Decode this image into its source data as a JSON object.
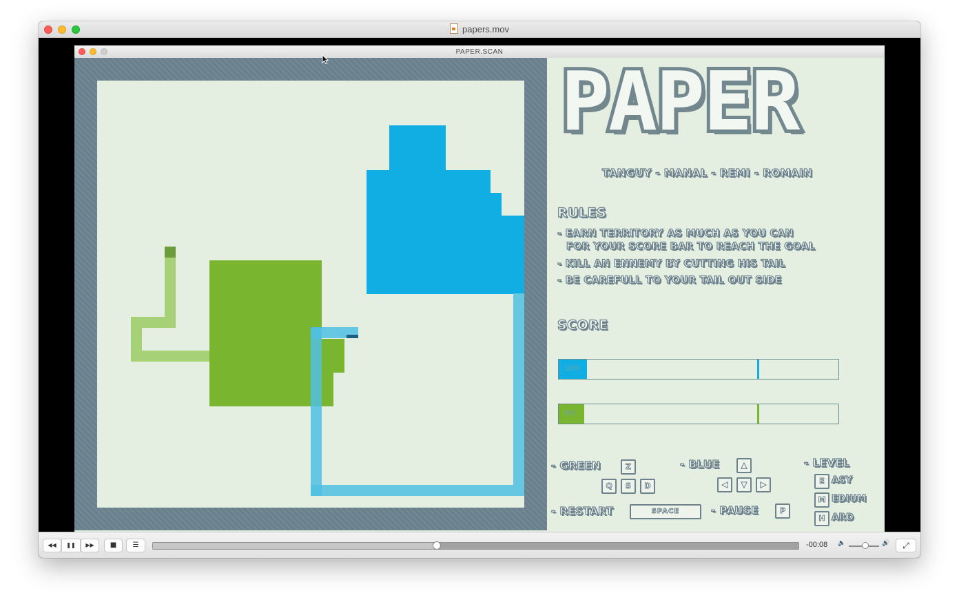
{
  "player": {
    "title": "papers.mov",
    "time_remaining": "-00:08",
    "playback_progress": 0.44,
    "volume_level": 0.55,
    "buttons": {
      "rewind": "◀◀",
      "pause": "❚❚",
      "forward": "▶▶",
      "stop": "■",
      "chapters": "☰",
      "volume_low": "🔈",
      "volume_high": "🔊",
      "fullscreen": "⤢"
    }
  },
  "game_window": {
    "title": "PAPER.SCAN"
  },
  "panel": {
    "logo": "PAPER",
    "credits": "TANGUY - MANAL - REMI - ROMAIN",
    "rules_heading": "RULES",
    "rules": [
      "- EARN TERRITORY AS MUCH AS YOU CAN",
      "FOR YOUR SCORE BAR TO REACH THE GOAL",
      "- KILL AN ENNEMY BY CUTTING HIS TAIL",
      "- BE CAREFULL TO YOUR TAIL OUT SIDE"
    ],
    "score_heading": "SCORE",
    "scores": [
      {
        "player": "blue",
        "label": "10%",
        "value": 0.1,
        "goal": 0.71,
        "color": "#10aee3"
      },
      {
        "player": "green",
        "label": "9%",
        "value": 0.09,
        "goal": 0.71,
        "color": "#79b52e"
      }
    ],
    "controls": {
      "green_label": "- GREEN",
      "green_keys": [
        "Z",
        "Q",
        "S",
        "D"
      ],
      "blue_label": "- BLUE",
      "blue_keys": [
        "▲",
        "◀",
        "▼",
        "▶"
      ],
      "level_label": "- LEVEL",
      "levels": [
        {
          "key": "E",
          "rest": "ASY"
        },
        {
          "key": "M",
          "rest": "EDIUM"
        },
        {
          "key": "H",
          "rest": "ARD"
        }
      ],
      "restart_label": "- RESTART",
      "restart_key": "SPACE",
      "pause_label": "- PAUSE",
      "pause_key": "P"
    }
  },
  "colors": {
    "blue_territory": "#10aee3",
    "blue_tail": "#66c7e2",
    "green_territory": "#79b52e",
    "green_tail": "#a6d177",
    "board_border": "#6c8390",
    "paper": "#e4efe1"
  }
}
